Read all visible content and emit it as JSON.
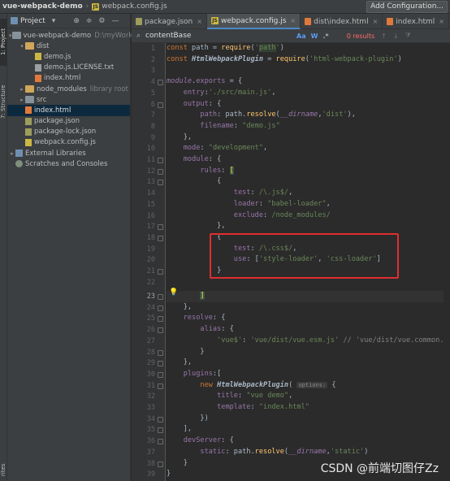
{
  "navbar": {
    "project": "vue-webpack-demo",
    "file": "webpack.config.js",
    "run_button": "Add Configuration..."
  },
  "tool_strip": {
    "project_tab": "1: Project",
    "structure_tab": "7: Structure",
    "favorites_tab": "rites"
  },
  "project_panel": {
    "title": "Project",
    "tree": [
      {
        "label": "vue-webpack-demo",
        "hint": "D:\\myWork",
        "depth": 0,
        "arrow": "▾",
        "icon": "folder"
      },
      {
        "label": "dist",
        "hint": "",
        "depth": 1,
        "arrow": "▾",
        "icon": "folder-orange"
      },
      {
        "label": "demo.js",
        "hint": "",
        "depth": 2,
        "arrow": "",
        "icon": "js"
      },
      {
        "label": "demo.js.LICENSE.txt",
        "hint": "",
        "depth": 2,
        "arrow": "",
        "icon": "txt"
      },
      {
        "label": "index.html",
        "hint": "",
        "depth": 2,
        "arrow": "",
        "icon": "html"
      },
      {
        "label": "node_modules",
        "hint": "library root",
        "depth": 1,
        "arrow": "▸",
        "icon": "folder-orange"
      },
      {
        "label": "src",
        "hint": "",
        "depth": 1,
        "arrow": "▸",
        "icon": "folder"
      },
      {
        "label": "index.html",
        "hint": "",
        "depth": 1,
        "arrow": "",
        "icon": "html",
        "selected": true
      },
      {
        "label": "package.json",
        "hint": "",
        "depth": 1,
        "arrow": "",
        "icon": "json"
      },
      {
        "label": "package-lock.json",
        "hint": "",
        "depth": 1,
        "arrow": "",
        "icon": "json"
      },
      {
        "label": "webpack.config.js",
        "hint": "",
        "depth": 1,
        "arrow": "",
        "icon": "js"
      },
      {
        "label": "External Libraries",
        "hint": "",
        "depth": 0,
        "arrow": "▸",
        "icon": "lib"
      },
      {
        "label": "Scratches and Consoles",
        "hint": "",
        "depth": 0,
        "arrow": "",
        "icon": "scratch"
      }
    ]
  },
  "editor_tabs": [
    {
      "label": "package.json",
      "icon": "json",
      "active": false
    },
    {
      "label": "webpack.config.js",
      "icon": "js",
      "active": true
    },
    {
      "label": "dist\\index.html",
      "icon": "html",
      "active": false
    },
    {
      "label": "index.html",
      "icon": "html",
      "active": false
    }
  ],
  "search": {
    "query": "contentBase",
    "match_case": "Aa",
    "words": "W",
    "regex": ".*",
    "results": "0 results"
  },
  "watermark": "CSDN @前端切图仔Zz",
  "line_numbers": [
    "1",
    "2",
    "3",
    "4",
    "5",
    "6",
    "7",
    "8",
    "9",
    "10",
    "11",
    "12",
    "13",
    "14",
    "15",
    "16",
    "17",
    "18",
    "19",
    "20",
    "21",
    "22",
    "23",
    "24",
    "25",
    "26",
    "27",
    "28",
    "29",
    "30",
    "31",
    "32",
    "33",
    "34",
    "35",
    "36",
    "37",
    "38",
    "39"
  ],
  "current_line": "23",
  "code_plain": [
    "",
    "",
    "",
    "",
    "        entry:'./src/main.js',",
    "",
    "",
    "",
    "        },",
    "",
    "",
    "",
    "            {",
    "",
    "",
    "",
    "            },",
    "            {",
    "",
    "",
    "            }",
    "",
    "",
    "        },",
    "",
    "",
    "",
    "            }",
    "        },",
    "",
    "",
    "",
    "",
    "            })",
    "        ],",
    "",
    "",
    "        }",
    "}"
  ]
}
